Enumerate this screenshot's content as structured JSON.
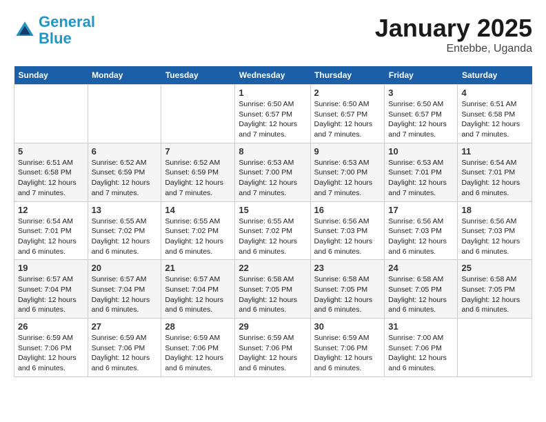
{
  "logo": {
    "line1": "General",
    "line2": "Blue"
  },
  "title": "January 2025",
  "subtitle": "Entebbe, Uganda",
  "days_of_week": [
    "Sunday",
    "Monday",
    "Tuesday",
    "Wednesday",
    "Thursday",
    "Friday",
    "Saturday"
  ],
  "weeks": [
    [
      {
        "day": "",
        "info": ""
      },
      {
        "day": "",
        "info": ""
      },
      {
        "day": "",
        "info": ""
      },
      {
        "day": "1",
        "info": "Sunrise: 6:50 AM\nSunset: 6:57 PM\nDaylight: 12 hours and 7 minutes."
      },
      {
        "day": "2",
        "info": "Sunrise: 6:50 AM\nSunset: 6:57 PM\nDaylight: 12 hours and 7 minutes."
      },
      {
        "day": "3",
        "info": "Sunrise: 6:50 AM\nSunset: 6:57 PM\nDaylight: 12 hours and 7 minutes."
      },
      {
        "day": "4",
        "info": "Sunrise: 6:51 AM\nSunset: 6:58 PM\nDaylight: 12 hours and 7 minutes."
      }
    ],
    [
      {
        "day": "5",
        "info": "Sunrise: 6:51 AM\nSunset: 6:58 PM\nDaylight: 12 hours and 7 minutes."
      },
      {
        "day": "6",
        "info": "Sunrise: 6:52 AM\nSunset: 6:59 PM\nDaylight: 12 hours and 7 minutes."
      },
      {
        "day": "7",
        "info": "Sunrise: 6:52 AM\nSunset: 6:59 PM\nDaylight: 12 hours and 7 minutes."
      },
      {
        "day": "8",
        "info": "Sunrise: 6:53 AM\nSunset: 7:00 PM\nDaylight: 12 hours and 7 minutes."
      },
      {
        "day": "9",
        "info": "Sunrise: 6:53 AM\nSunset: 7:00 PM\nDaylight: 12 hours and 7 minutes."
      },
      {
        "day": "10",
        "info": "Sunrise: 6:53 AM\nSunset: 7:01 PM\nDaylight: 12 hours and 7 minutes."
      },
      {
        "day": "11",
        "info": "Sunrise: 6:54 AM\nSunset: 7:01 PM\nDaylight: 12 hours and 6 minutes."
      }
    ],
    [
      {
        "day": "12",
        "info": "Sunrise: 6:54 AM\nSunset: 7:01 PM\nDaylight: 12 hours and 6 minutes."
      },
      {
        "day": "13",
        "info": "Sunrise: 6:55 AM\nSunset: 7:02 PM\nDaylight: 12 hours and 6 minutes."
      },
      {
        "day": "14",
        "info": "Sunrise: 6:55 AM\nSunset: 7:02 PM\nDaylight: 12 hours and 6 minutes."
      },
      {
        "day": "15",
        "info": "Sunrise: 6:55 AM\nSunset: 7:02 PM\nDaylight: 12 hours and 6 minutes."
      },
      {
        "day": "16",
        "info": "Sunrise: 6:56 AM\nSunset: 7:03 PM\nDaylight: 12 hours and 6 minutes."
      },
      {
        "day": "17",
        "info": "Sunrise: 6:56 AM\nSunset: 7:03 PM\nDaylight: 12 hours and 6 minutes."
      },
      {
        "day": "18",
        "info": "Sunrise: 6:56 AM\nSunset: 7:03 PM\nDaylight: 12 hours and 6 minutes."
      }
    ],
    [
      {
        "day": "19",
        "info": "Sunrise: 6:57 AM\nSunset: 7:04 PM\nDaylight: 12 hours and 6 minutes."
      },
      {
        "day": "20",
        "info": "Sunrise: 6:57 AM\nSunset: 7:04 PM\nDaylight: 12 hours and 6 minutes."
      },
      {
        "day": "21",
        "info": "Sunrise: 6:57 AM\nSunset: 7:04 PM\nDaylight: 12 hours and 6 minutes."
      },
      {
        "day": "22",
        "info": "Sunrise: 6:58 AM\nSunset: 7:05 PM\nDaylight: 12 hours and 6 minutes."
      },
      {
        "day": "23",
        "info": "Sunrise: 6:58 AM\nSunset: 7:05 PM\nDaylight: 12 hours and 6 minutes."
      },
      {
        "day": "24",
        "info": "Sunrise: 6:58 AM\nSunset: 7:05 PM\nDaylight: 12 hours and 6 minutes."
      },
      {
        "day": "25",
        "info": "Sunrise: 6:58 AM\nSunset: 7:05 PM\nDaylight: 12 hours and 6 minutes."
      }
    ],
    [
      {
        "day": "26",
        "info": "Sunrise: 6:59 AM\nSunset: 7:06 PM\nDaylight: 12 hours and 6 minutes."
      },
      {
        "day": "27",
        "info": "Sunrise: 6:59 AM\nSunset: 7:06 PM\nDaylight: 12 hours and 6 minutes."
      },
      {
        "day": "28",
        "info": "Sunrise: 6:59 AM\nSunset: 7:06 PM\nDaylight: 12 hours and 6 minutes."
      },
      {
        "day": "29",
        "info": "Sunrise: 6:59 AM\nSunset: 7:06 PM\nDaylight: 12 hours and 6 minutes."
      },
      {
        "day": "30",
        "info": "Sunrise: 6:59 AM\nSunset: 7:06 PM\nDaylight: 12 hours and 6 minutes."
      },
      {
        "day": "31",
        "info": "Sunrise: 7:00 AM\nSunset: 7:06 PM\nDaylight: 12 hours and 6 minutes."
      },
      {
        "day": "",
        "info": ""
      }
    ]
  ]
}
